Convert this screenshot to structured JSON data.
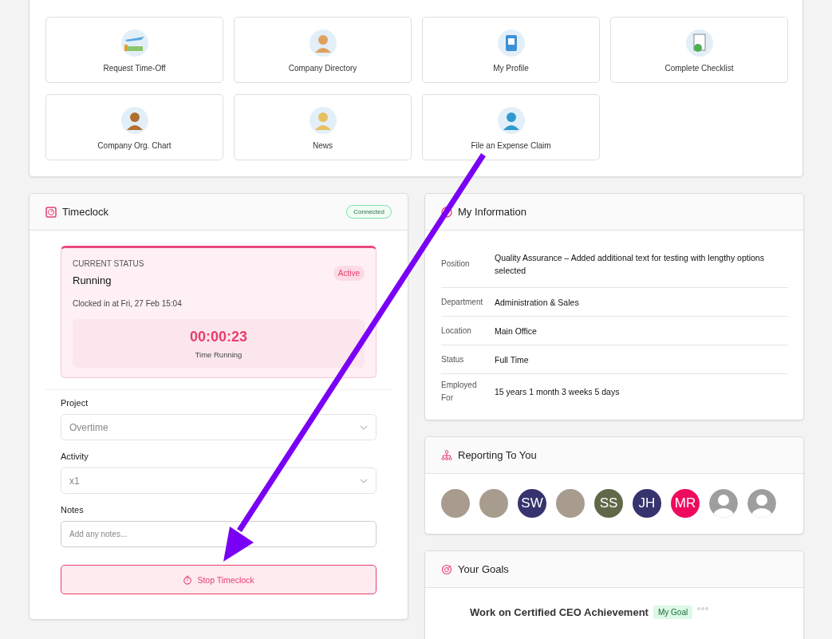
{
  "shortcuts": [
    {
      "label": "Request Time-Off"
    },
    {
      "label": "Company Directory"
    },
    {
      "label": "My Profile"
    },
    {
      "label": "Complete Checklist"
    },
    {
      "label": "Company Org. Chart"
    },
    {
      "label": "News"
    },
    {
      "label": "File an Expense Claim"
    }
  ],
  "timeclock": {
    "title": "Timeclock",
    "connection": "Connected",
    "status_label": "CURRENT STATUS",
    "status": "Running",
    "badge": "Active",
    "clocked_in": "Clocked in at Fri, 27 Feb 15:04",
    "timer": "00:00:23",
    "timer_label": "Time Running",
    "fields": [
      {
        "kind": "select",
        "label": "Project",
        "value": "Overtime"
      },
      {
        "kind": "select",
        "label": "Activity",
        "value": "x1"
      },
      {
        "kind": "text",
        "label": "Notes",
        "placeholder": "Add any notes..."
      }
    ],
    "stop_button": "Stop Timeclock"
  },
  "my_information": {
    "title": "My Information",
    "rows": [
      {
        "label": "Position",
        "value": "Quality Assurance – Added additional text for testing with lengthy options selected"
      },
      {
        "label": "Department",
        "value": "Administration & Sales"
      },
      {
        "label": "Location",
        "value": "Main Office"
      },
      {
        "label": "Status",
        "value": "Full Time"
      },
      {
        "label": "Employed For",
        "value": "15 years 1 month 3 weeks 5 days"
      }
    ]
  },
  "reporting_to_you": {
    "title": "Reporting To You",
    "people": [
      {
        "kind": "photo"
      },
      {
        "kind": "photo"
      },
      {
        "kind": "initials",
        "initials": "SW",
        "color": "#36336e"
      },
      {
        "kind": "photo"
      },
      {
        "kind": "initials",
        "initials": "SS",
        "color": "#5f6848"
      },
      {
        "kind": "initials",
        "initials": "JH",
        "color": "#36336e"
      },
      {
        "kind": "initials",
        "initials": "MR",
        "color": "#ee0b5d"
      },
      {
        "kind": "default"
      },
      {
        "kind": "default"
      }
    ]
  },
  "your_goals": {
    "title": "Your Goals",
    "goals": [
      {
        "title": "Work on Certified CEO Achievement",
        "tag": "My Goal"
      }
    ]
  }
}
